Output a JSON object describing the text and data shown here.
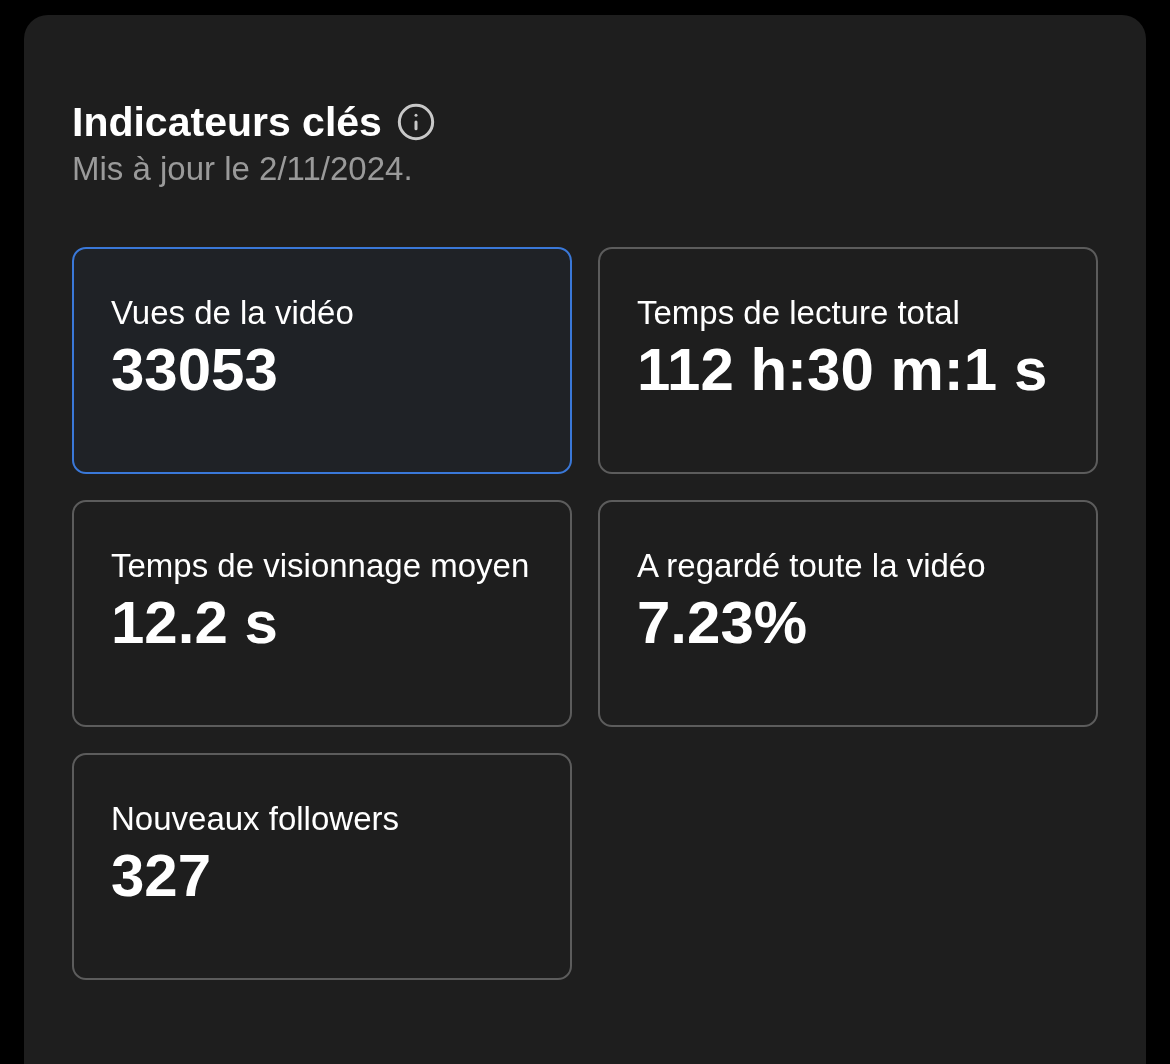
{
  "panel": {
    "title": "Indicateurs clés",
    "subtitle": "Mis à jour le 2/11/2024."
  },
  "metrics": [
    {
      "label": "Vues de la vidéo",
      "value": "33053",
      "selected": true
    },
    {
      "label": "Temps de lecture total",
      "value": "112 h:30 m:1 s",
      "selected": false
    },
    {
      "label": "Temps de visionnage moyen",
      "value": "12.2 s",
      "selected": false
    },
    {
      "label": "A regardé toute la vidéo",
      "value": "7.23%",
      "selected": false
    },
    {
      "label": "Nouveaux followers",
      "value": "327",
      "selected": false
    }
  ]
}
